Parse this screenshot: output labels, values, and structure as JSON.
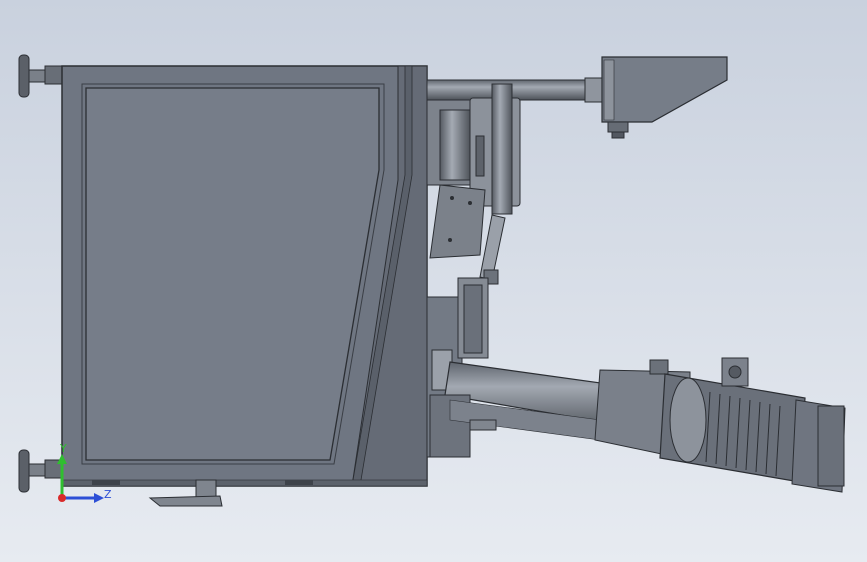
{
  "viewport": {
    "background_top": "#c9d1de",
    "background_bottom": "#e7ebf1"
  },
  "palette": {
    "cabinet": "#6f7682",
    "cabinet_dark": "#4f5560",
    "cabinet_panel": "#757c88",
    "edge": "#2b2e33",
    "metal": "#8a9099",
    "metal_light": "#a7adb6",
    "metal_dark": "#5c6169"
  },
  "triad": {
    "y_label": "Y",
    "z_label": "Z",
    "y_color": "#2fbf2f",
    "z_color": "#2d4fd6",
    "x_color": "#d92a2a"
  }
}
